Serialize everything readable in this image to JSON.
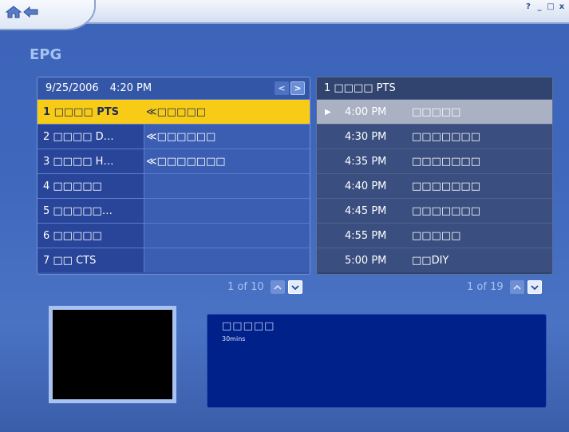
{
  "window": {
    "home_icon": "home-icon",
    "back_icon": "back-arrow-icon",
    "help_label": "?",
    "minimize_label": "_",
    "maximize_label": "□",
    "close_label": "x"
  },
  "page_title": "EPG",
  "channels": {
    "date": "9/25/2006",
    "time": "4:20 PM",
    "prev_label": "<",
    "next_label": ">",
    "rows": [
      {
        "name": "1 □□□□ PTS",
        "program": "≪□□□□□",
        "selected": true
      },
      {
        "name": "2 □□□□ D…",
        "program": "≪□□□□□□"
      },
      {
        "name": "3 □□□□ H…",
        "program": "≪□□□□□□□"
      },
      {
        "name": "4 □□□□□",
        "program": ""
      },
      {
        "name": "5 □□□□□…",
        "program": ""
      },
      {
        "name": "6 □□□□□",
        "program": ""
      },
      {
        "name": "7 □□ CTS",
        "program": ""
      }
    ],
    "pager": {
      "label": "1 of 10",
      "up": "^",
      "down": "v"
    }
  },
  "schedule": {
    "header": "1 □□□□ PTS",
    "rows": [
      {
        "time": "4:00 PM",
        "title": "□□□□□",
        "selected": true
      },
      {
        "time": "4:30 PM",
        "title": "□□□□□□□"
      },
      {
        "time": "4:35 PM",
        "title": "□□□□□□□"
      },
      {
        "time": "4:40 PM",
        "title": "□□□□□□□"
      },
      {
        "time": "4:45 PM",
        "title": "□□□□□□□"
      },
      {
        "time": "4:55 PM",
        "title": "□□□□□"
      },
      {
        "time": "5:00 PM",
        "title": "□□DIY"
      }
    ],
    "pager": {
      "label": "1 of 19",
      "up": "^",
      "down": "v"
    }
  },
  "info": {
    "title": "□□□□□",
    "duration": "30mins"
  },
  "colors": {
    "accent": "#f8cc16",
    "background": "#3f68bd",
    "info_panel": "#00208a"
  }
}
